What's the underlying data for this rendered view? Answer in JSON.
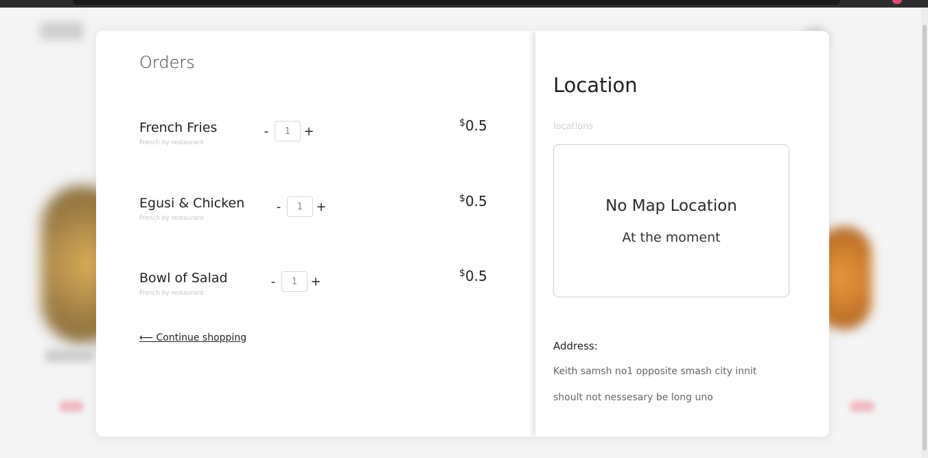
{
  "colors": {
    "accent_pink": "#e24a72",
    "modal_bg": "#ffffff",
    "text_dark": "#1f1f1f"
  },
  "orders": {
    "title": "Orders",
    "items": [
      {
        "name": "French Fries",
        "subtitle": "French by restaurant",
        "quantity": "1",
        "currency": "$",
        "price": "0.5",
        "minus": "-",
        "plus": "+"
      },
      {
        "name": "Egusi & Chicken",
        "subtitle": "French by restaurant",
        "quantity": "1",
        "currency": "$",
        "price": "0.5",
        "minus": "-",
        "plus": "+"
      },
      {
        "name": "Bowl of Salad",
        "subtitle": "French by restaurant",
        "quantity": "1",
        "currency": "$",
        "price": "0.5",
        "minus": "-",
        "plus": "+"
      }
    ],
    "continue_label": "⟵ Continue shopping"
  },
  "location": {
    "title": "Location",
    "field_label": "locations",
    "map_empty_title": "No Map Location",
    "map_empty_subtitle": "At the moment",
    "address_label": "Address:",
    "address_lines": [
      "Keith samsh no1 opposite smash city innit",
      "shoult not nessesary be long uno"
    ]
  }
}
